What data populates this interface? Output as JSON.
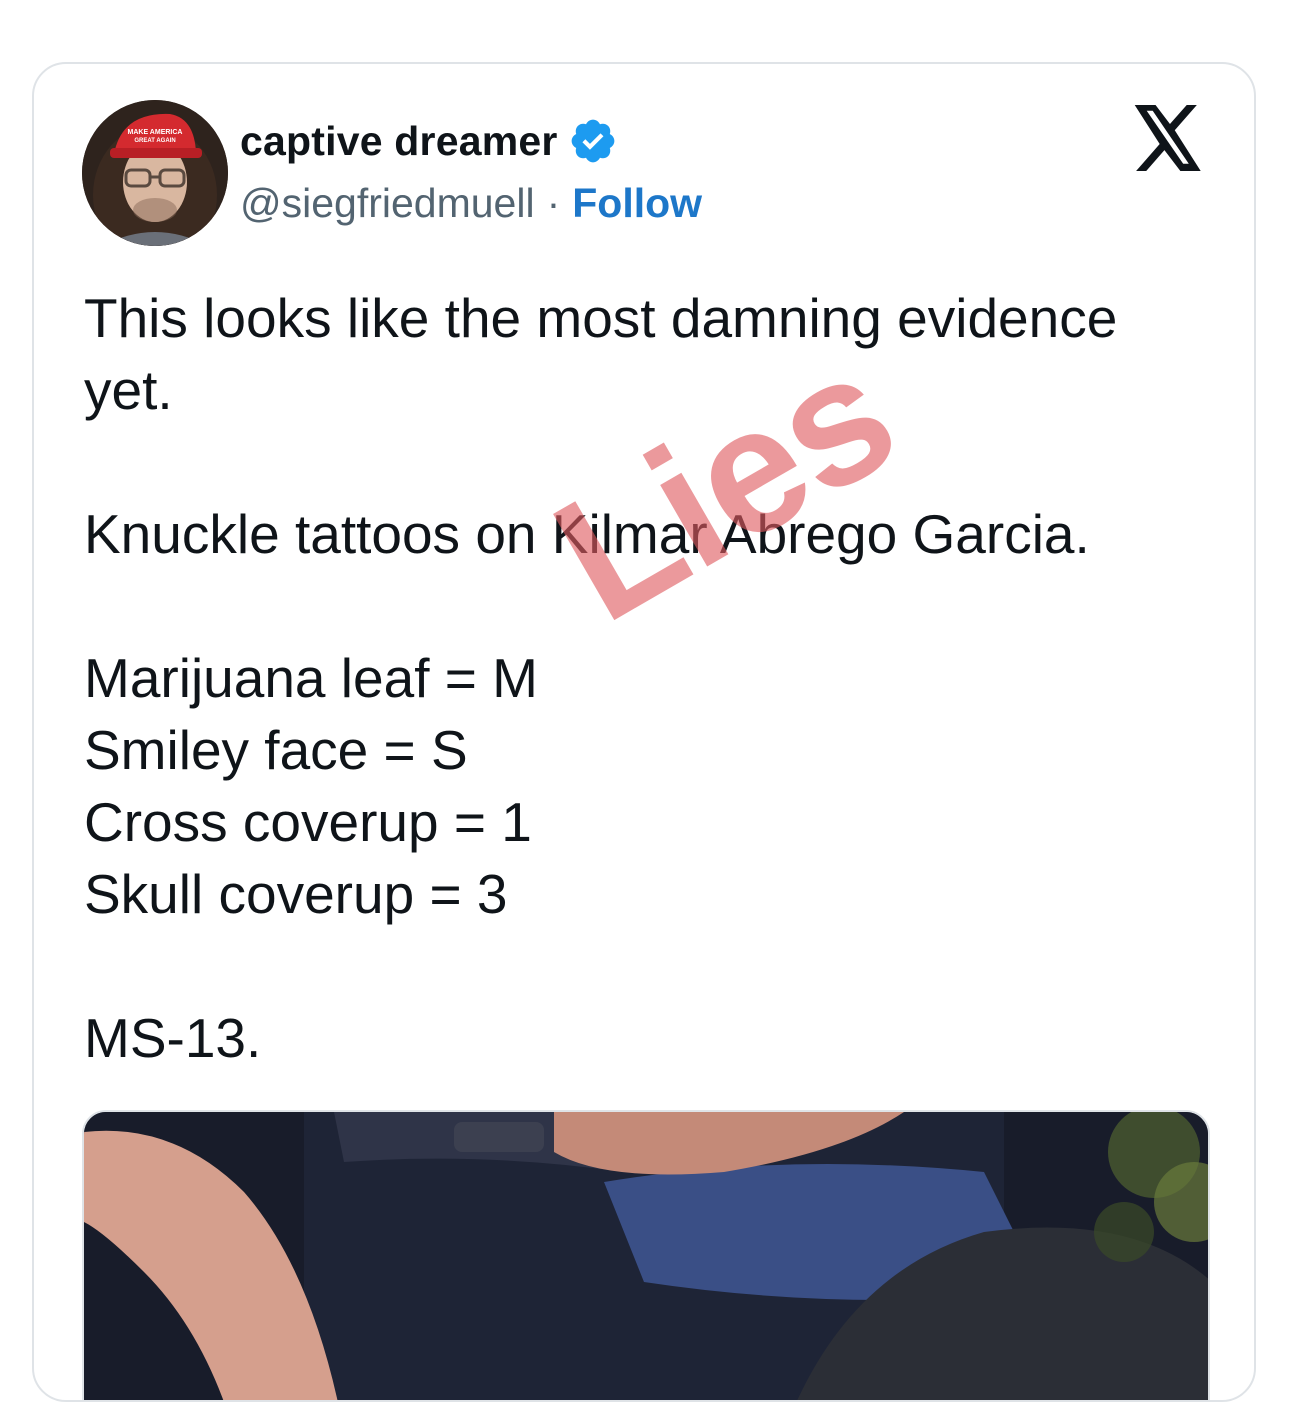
{
  "tweet": {
    "author": {
      "display_name": "captive dreamer",
      "handle": "@siegfriedmuell",
      "separator": "·",
      "follow_label": "Follow",
      "verified": true,
      "avatar_icon": "profile-photo-red-cap"
    },
    "platform_icon": "x-logo-icon",
    "lines": [
      "This looks like the most damning evidence yet.",
      "",
      "Knuckle tattoos on Kilmar Abrego Garcia.",
      "",
      "Marijuana leaf = M",
      "Smiley face = S",
      "Cross coverup = 1",
      "Skull coverup = 3",
      "",
      "MS-13."
    ],
    "media": {
      "type": "photo"
    }
  },
  "overlay": {
    "watermark_text": "Lies",
    "watermark_color": "#de5a5f"
  },
  "colors": {
    "text": "#0f1419",
    "secondary": "#536471",
    "follow": "#1d77c9",
    "verified": "#1d9bf0",
    "border": "#dfe3e7"
  }
}
